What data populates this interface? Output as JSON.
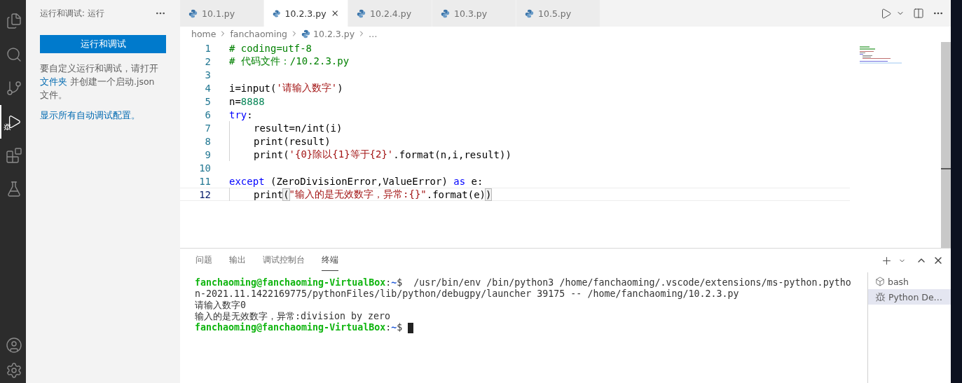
{
  "activity_bar": {
    "items": [
      {
        "kind": "files",
        "selected": false
      },
      {
        "kind": "search",
        "selected": false
      },
      {
        "kind": "scm",
        "selected": false
      },
      {
        "kind": "debug",
        "selected": true
      },
      {
        "kind": "extensions",
        "selected": false
      },
      {
        "kind": "testing",
        "selected": false
      }
    ]
  },
  "sidebar": {
    "title": "运行和调试: 运行",
    "run_button": "运行和调试",
    "description": {
      "before": "要自定义运行和调试，请打开 ",
      "link": "文件夹",
      "after": " 并创建一个启动.json 文件。"
    },
    "show_all_link": "显示所有自动调试配置。"
  },
  "tabs": [
    {
      "label": "10.1.py",
      "selected": false
    },
    {
      "label": "10.2.3.py",
      "selected": true
    },
    {
      "label": "10.2.4.py",
      "selected": false
    },
    {
      "label": "10.3.py",
      "selected": false
    },
    {
      "label": "10.5.py",
      "selected": false
    }
  ],
  "breadcrumb": [
    "home",
    "fanchaoming",
    "10.2.3.py",
    "…"
  ],
  "editor": {
    "lines": [
      {
        "number": "1",
        "current": false,
        "tokens": [
          {
            "kind": "comment",
            "text": "# coding=utf-8"
          }
        ]
      },
      {
        "number": "2",
        "current": false,
        "tokens": [
          {
            "kind": "comment",
            "text": "# 代码文件：/10.2.3.py"
          }
        ]
      },
      {
        "number": "3",
        "current": false
      },
      {
        "number": "4",
        "current": false,
        "tokens": [
          {
            "kind": "plain",
            "text": "i=input("
          },
          {
            "kind": "string",
            "text": "'请输入数字'"
          },
          {
            "kind": "plain",
            "text": ")"
          }
        ]
      },
      {
        "number": "5",
        "current": false,
        "tokens": [
          {
            "kind": "plain",
            "text": "n="
          },
          {
            "kind": "number",
            "text": "8888"
          }
        ]
      },
      {
        "number": "6",
        "current": false,
        "tokens": [
          {
            "kind": "keyword",
            "text": "try"
          },
          {
            "kind": "plain",
            "text": ":"
          }
        ]
      },
      {
        "number": "7",
        "current": false,
        "indented": true,
        "tokens": [
          {
            "kind": "plain",
            "text": "result=n/int(i)"
          }
        ]
      },
      {
        "number": "8",
        "current": false,
        "indented": true,
        "tokens": [
          {
            "kind": "plain",
            "text": "print(result)"
          }
        ]
      },
      {
        "number": "9",
        "current": false,
        "indented": true,
        "tokens": [
          {
            "kind": "plain",
            "text": "print("
          },
          {
            "kind": "string",
            "text": "'{0}除以{1}等于{2}'"
          },
          {
            "kind": "plain",
            "text": ".format(n,i,result))"
          }
        ]
      },
      {
        "number": "10",
        "current": false
      },
      {
        "number": "11",
        "current": false,
        "tokens": [
          {
            "kind": "keyword",
            "text": "except"
          },
          {
            "kind": "plain",
            "text": " (ZeroDivisionError,ValueError) "
          },
          {
            "kind": "keyword",
            "text": "as"
          },
          {
            "kind": "plain",
            "text": " e:"
          }
        ]
      },
      {
        "number": "12",
        "current": true,
        "indented": true,
        "tokens": [
          {
            "kind": "plain",
            "text": "print"
          },
          {
            "kind": "bracket",
            "text": "("
          },
          {
            "kind": "string",
            "text": "\"输入的是无效数字，异常:{}\""
          },
          {
            "kind": "plain",
            "text": ".format(e)"
          },
          {
            "kind": "bracket",
            "text": ")"
          }
        ]
      }
    ]
  },
  "panel": {
    "tabs": [
      {
        "label": "问题",
        "selected": false
      },
      {
        "label": "输出",
        "selected": false
      },
      {
        "label": "调试控制台",
        "selected": false
      },
      {
        "label": "终端",
        "selected": true
      }
    ],
    "terminal_lines": [
      [
        {
          "kind": "prompt",
          "text": "fanchaoming@fanchaoming-VirtualBox"
        },
        {
          "kind": "plain",
          "text": ":"
        },
        {
          "kind": "path",
          "text": "~"
        },
        {
          "kind": "plain",
          "text": "$  /usr/bin/env /bin/python3 /home/fanchaoming/.vscode/extensions/ms-python.pytho"
        }
      ],
      [
        {
          "kind": "plain",
          "text": "n-2021.11.1422169775/pythonFiles/lib/python/debugpy/launcher 39175 -- /home/fanchaoming/10.2.3.py"
        }
      ],
      [
        {
          "kind": "plain",
          "text": "请输入数字0"
        }
      ],
      [
        {
          "kind": "plain",
          "text": "输入的是无效数字，异常:division by zero"
        }
      ],
      [
        {
          "kind": "prompt",
          "text": "fanchaoming@fanchaoming-VirtualBox"
        },
        {
          "kind": "plain",
          "text": ":"
        },
        {
          "kind": "path",
          "text": "~"
        },
        {
          "kind": "plain",
          "text": "$ "
        }
      ]
    ],
    "terminals": [
      {
        "kind": "shell",
        "label": "bash",
        "selected": false
      },
      {
        "kind": "debug",
        "label": "Python De…",
        "selected": true
      }
    ]
  }
}
